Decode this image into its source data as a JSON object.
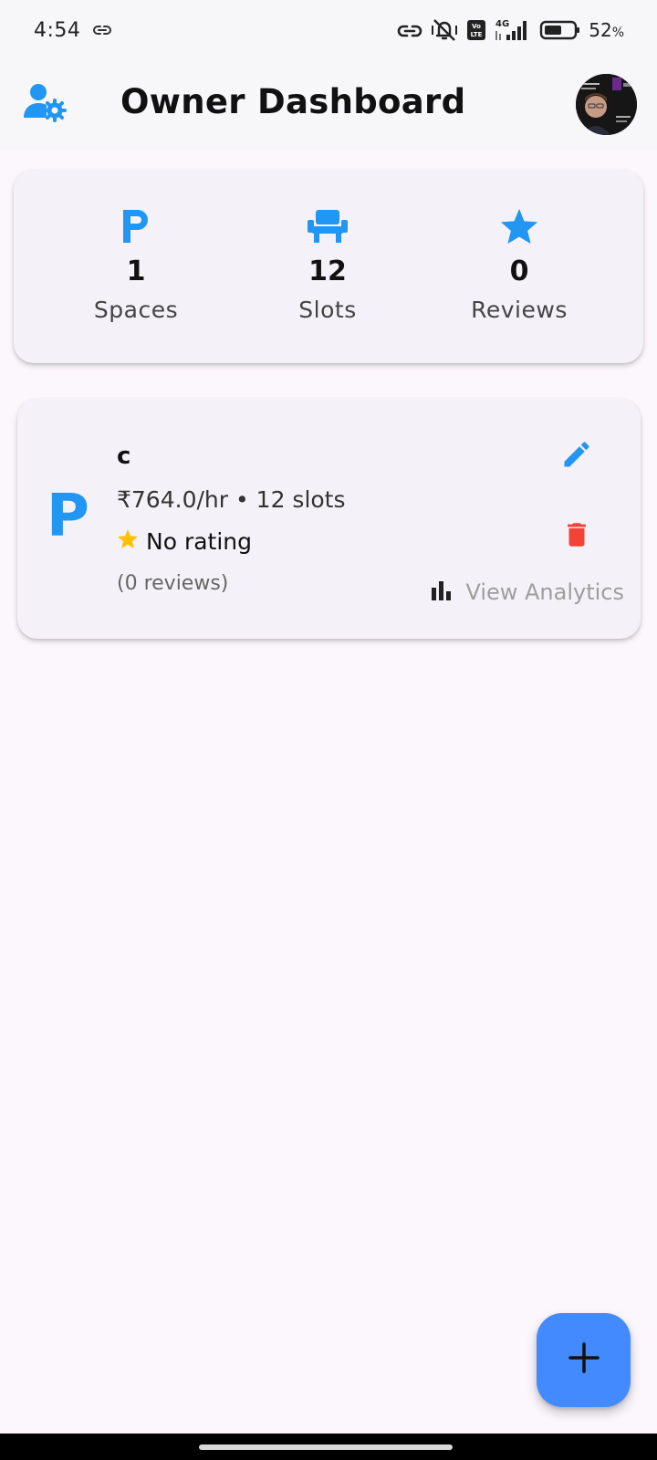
{
  "status_bar": {
    "time": "4:54",
    "battery_percent": "52",
    "battery_unit": "%",
    "network": "4G",
    "volte": "Vo LTE",
    "icons": [
      "link-icon",
      "hotspot-icon",
      "vibrate-mute-icon",
      "volte-icon",
      "signal-icon",
      "battery-icon"
    ]
  },
  "app_bar": {
    "title": "Owner Dashboard",
    "leading_icon": "manage-accounts-icon",
    "avatar": "profile-avatar"
  },
  "stats": [
    {
      "icon": "parking-icon",
      "value": "1",
      "label": "Spaces"
    },
    {
      "icon": "chair-icon",
      "value": "12",
      "label": "Slots"
    },
    {
      "icon": "star-icon",
      "value": "0",
      "label": "Reviews"
    }
  ],
  "space": {
    "icon_letter": "P",
    "name": "c",
    "price_line": "₹764.0/hr • 12 slots",
    "rating": "No rating",
    "reviews": "(0 reviews)",
    "analytics_label": "View Analytics",
    "actions": [
      "edit-icon",
      "delete-icon"
    ]
  },
  "fab": {
    "icon": "add-icon"
  },
  "colors": {
    "accent": "#2196f3",
    "fab": "#448aff",
    "delete": "#f44336",
    "star": "#ffc107",
    "background": "#fcf7fd",
    "card": "#f5f1f8"
  }
}
